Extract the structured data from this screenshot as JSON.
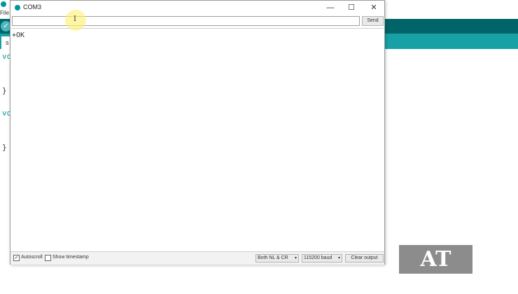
{
  "ide": {
    "menu": "File",
    "tab_char": "s",
    "code_lines": [
      "vo",
      "}",
      "vo",
      "}"
    ],
    "verify_symbol": "✓",
    "colors": {
      "toolbar": "#006468",
      "tabbar": "#17a1a5",
      "accent": "#00979c"
    }
  },
  "serial_monitor": {
    "title": "COM3",
    "controls": {
      "minimize": "—",
      "maximize": "☐",
      "close": "✕"
    },
    "input": {
      "value": "",
      "placeholder": ""
    },
    "send_label": "Send",
    "output_lines": [
      "+OK"
    ],
    "autoscroll": {
      "label": "Autoscroll",
      "checked": true,
      "mark": "✓"
    },
    "timestamp": {
      "label": "Show timestamp",
      "checked": false,
      "mark": ""
    },
    "line_ending": {
      "selected": "Both NL & CR",
      "chevron": "▾"
    },
    "baud_rate": {
      "selected": "115200 baud",
      "chevron": "▾"
    },
    "clear_label": "Clear output"
  },
  "cursor": {
    "glyph": "I"
  },
  "badge": {
    "text": "AT"
  }
}
